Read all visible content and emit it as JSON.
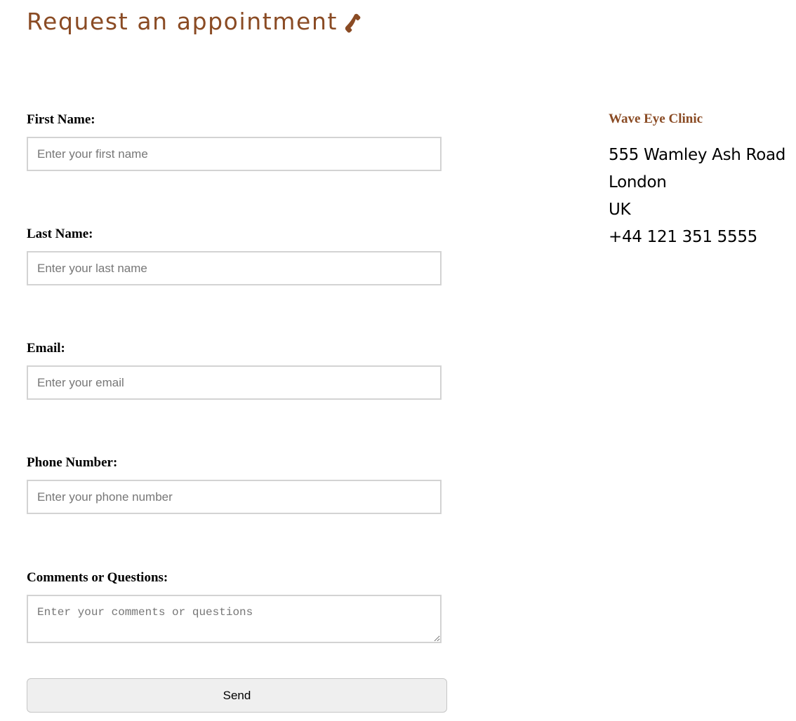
{
  "header": {
    "title": "Request an appointment",
    "icon": "phone-icon",
    "accent_color": "#8a4b24"
  },
  "form": {
    "first_name": {
      "label": "First Name:",
      "placeholder": "Enter your first name",
      "value": ""
    },
    "last_name": {
      "label": "Last Name:",
      "placeholder": "Enter your last name",
      "value": ""
    },
    "email": {
      "label": "Email:",
      "placeholder": "Enter your email",
      "value": ""
    },
    "phone": {
      "label": "Phone Number:",
      "placeholder": "Enter your phone number",
      "value": ""
    },
    "comments": {
      "label": "Comments or Questions:",
      "placeholder": "Enter your comments or questions",
      "value": ""
    },
    "send_label": "Send"
  },
  "clinic": {
    "name": "Wave Eye Clinic",
    "address_line1": "555 Wamley Ash Road",
    "city": "London",
    "country": "UK",
    "phone": "+44 121 351 5555"
  }
}
